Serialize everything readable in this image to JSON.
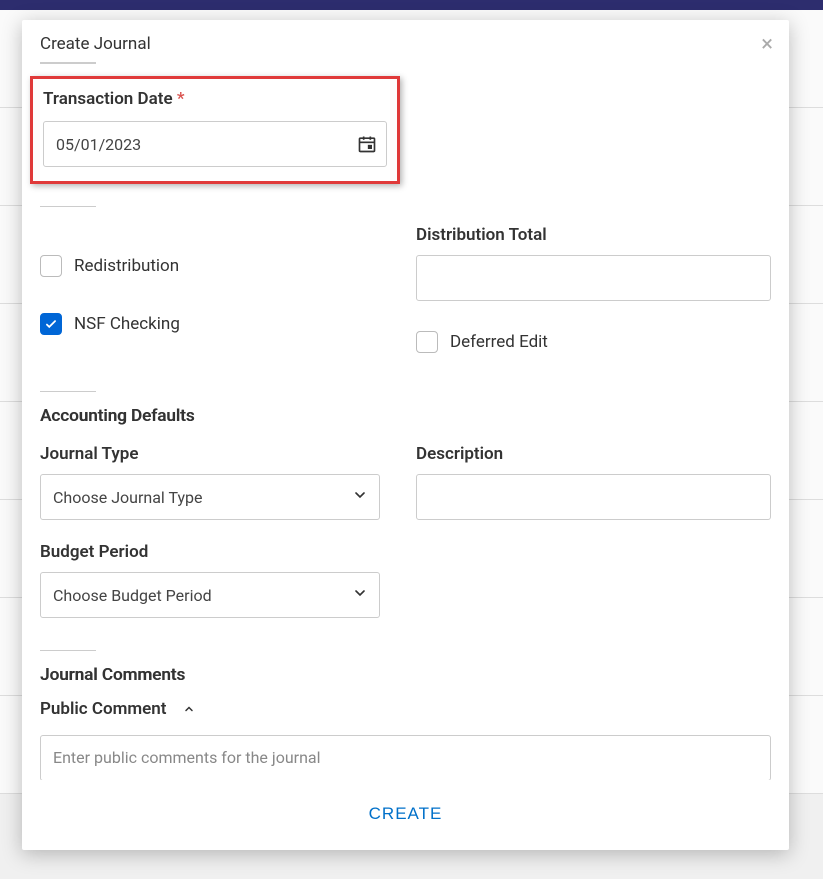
{
  "modal": {
    "title": "Create Journal",
    "transaction_date": {
      "label": "Transaction Date",
      "value": "05/01/2023"
    },
    "distribution_total": {
      "label": "Distribution Total",
      "value": ""
    },
    "redistribution": {
      "label": "Redistribution"
    },
    "nsf_checking": {
      "label": "NSF Checking"
    },
    "deferred_edit": {
      "label": "Deferred Edit"
    },
    "accounting_defaults": {
      "heading": "Accounting Defaults"
    },
    "journal_type": {
      "label": "Journal Type",
      "placeholder": "Choose Journal Type"
    },
    "description": {
      "label": "Description",
      "value": ""
    },
    "budget_period": {
      "label": "Budget Period",
      "placeholder": "Choose Budget Period"
    },
    "journal_comments": {
      "heading": "Journal Comments"
    },
    "public_comment": {
      "label": "Public Comment",
      "placeholder": "Enter public comments for the journal"
    },
    "footer": {
      "create": "CREATE"
    }
  }
}
